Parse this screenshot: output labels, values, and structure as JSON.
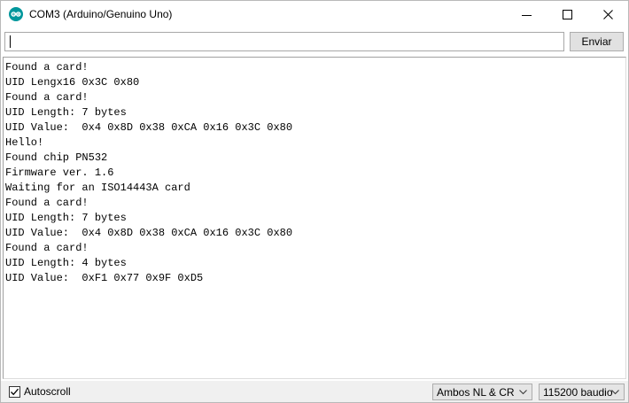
{
  "window": {
    "title": "COM3 (Arduino/Genuino Uno)",
    "app_icon": "arduino-logo-icon",
    "controls": [
      "minimize-icon",
      "maximize-icon",
      "close-icon"
    ]
  },
  "toolbar": {
    "input_value": "",
    "send_label": "Enviar"
  },
  "output": {
    "lines": [
      "Found a card!",
      "UID Lengx16 0x3C 0x80",
      "Found a card!",
      "UID Length: 7 bytes",
      "UID Value:  0x4 0x8D 0x38 0xCA 0x16 0x3C 0x80",
      "Hello!",
      "Found chip PN532",
      "Firmware ver. 1.6",
      "Waiting for an ISO14443A card",
      "Found a card!",
      "UID Length: 7 bytes",
      "UID Value:  0x4 0x8D 0x38 0xCA 0x16 0x3C 0x80",
      "Found a card!",
      "UID Length: 4 bytes",
      "UID Value:  0xF1 0x77 0x9F 0xD5"
    ]
  },
  "statusbar": {
    "autoscroll_label": "Autoscroll",
    "autoscroll_checked": true,
    "line_ending": "Ambos NL & CR",
    "baud_rate": "115200 baudio"
  },
  "colors": {
    "arduino_teal": "#00979c",
    "button_face": "#e1e1e1",
    "statusbar_bg": "#f0f0f0"
  }
}
